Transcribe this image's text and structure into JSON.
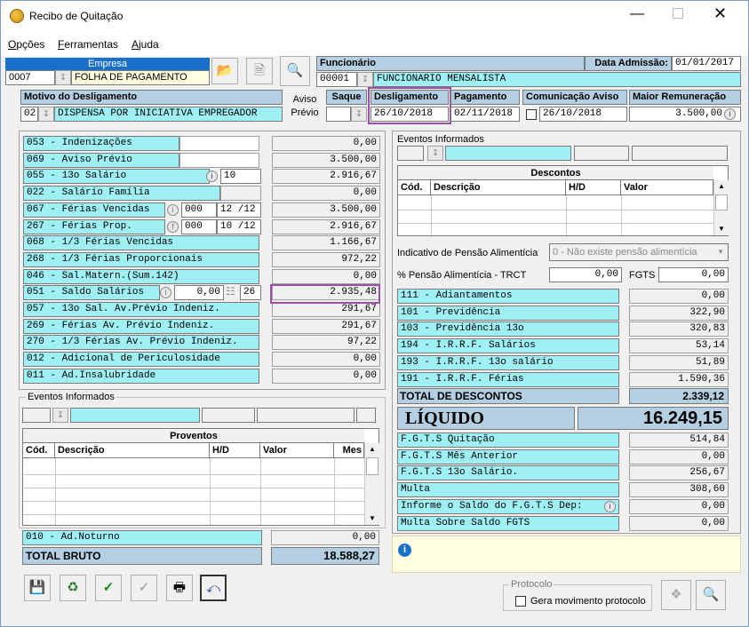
{
  "window": {
    "title": "Recibo de Quitação"
  },
  "menu": [
    {
      "first": "O",
      "rest": "pções"
    },
    {
      "first": "F",
      "rest": "erramentas"
    },
    {
      "first": "A",
      "rest": "juda"
    }
  ],
  "empresa": {
    "label": "Empresa",
    "code": "0007",
    "name": "FOLHA DE PAGAMENTO"
  },
  "funcionario": {
    "label": "Funcionário",
    "code": "00001",
    "name": "FUNCIONARIO MENSALISTA"
  },
  "admissao": {
    "label": "Data Admissão:",
    "value": "01/01/2017"
  },
  "motivo": {
    "label": "Motivo do Desligamento",
    "code": "02",
    "name": "DISPENSA POR INICIATIVA EMPREGADOR"
  },
  "aviso": {
    "line1": "Aviso",
    "line2": "Prévio"
  },
  "saque": {
    "label": "Saque"
  },
  "desligamento": {
    "label": "Desligamento",
    "value": "26/10/2018"
  },
  "pagamento": {
    "label": "Pagamento",
    "value": "02/11/2018"
  },
  "comunicacao": {
    "label": "Comunicação Aviso",
    "value": "26/10/2018"
  },
  "remuneracao": {
    "label": "Maior Remuneração",
    "value": "3.500,00"
  },
  "proventos_rows": [
    {
      "label": "053 - Indenizações",
      "value": "0,00"
    },
    {
      "label": "069 - Aviso Prévio",
      "value": "3.500,00"
    },
    {
      "label": "055 - 13o Salário",
      "extra": "10",
      "value": "2.916,67"
    },
    {
      "label": "022 - Salário Família",
      "value": "0,00"
    },
    {
      "label": "067 - Férias Vencidas",
      "extra": "000",
      "extra2": "12 /12",
      "value": "3.500,00"
    },
    {
      "label": "267 - Férias Prop.",
      "extra": "000",
      "extra2": "10 /12",
      "value": "2.916,67"
    },
    {
      "label": "068 - 1/3 Férias Vencidas",
      "value": "1.166,67"
    },
    {
      "label": "268 - 1/3 Férias Proporcionais",
      "value": "972,22"
    },
    {
      "label": "046 - Sal.Matern.(Sum.142)",
      "value": "0,00"
    },
    {
      "label": "051 - Saldo Salários",
      "extra": "0,00",
      "extra2": "26",
      "value": "2.935,48"
    },
    {
      "label": "057 - 13o Sal. Av.Prévio Indeniz.",
      "value": "291,67"
    },
    {
      "label": "269 - Férias  Av. Prévio Indeniz.",
      "value": "291,67"
    },
    {
      "label": "270 - 1/3 Férias Av. Prévio Indeniz.",
      "value": "97,22"
    },
    {
      "label": "012 - Adicional de Periculosidade",
      "value": "0,00"
    },
    {
      "label": "011 - Ad.Insalubridade",
      "value": "0,00"
    }
  ],
  "eventos_left": {
    "legend": "Eventos Informados",
    "grid_title": "Proventos",
    "columns": [
      "Cód.",
      "Descrição",
      "H/D",
      "Valor",
      "Mes"
    ]
  },
  "adnoturno": {
    "label": "010 - Ad.Noturno",
    "value": "0,00"
  },
  "total_bruto": {
    "label": "TOTAL BRUTO",
    "value": "18.588,27"
  },
  "eventos_right": {
    "legend": "Eventos Informados",
    "grid_title": "Descontos",
    "columns": [
      "Cód.",
      "Descrição",
      "H/D",
      "Valor"
    ]
  },
  "pensao": {
    "label": "Indicativo de Pensão Alimentícia",
    "value": "0 - Não existe pensão alimentícia"
  },
  "pensao_trct": {
    "label": "% Pensão Alimentícia - TRCT",
    "value": "0,00"
  },
  "fgts": {
    "label": "FGTS",
    "value": "0,00"
  },
  "descontos_rows": [
    {
      "label": "111 - Adiantamentos",
      "value": "0,00"
    },
    {
      "label": "101 - Previdência",
      "value": "322,90"
    },
    {
      "label": "103 - Previdência 13o",
      "value": "320,83"
    },
    {
      "label": "194 - I.R.R.F. Salários",
      "value": "53,14"
    },
    {
      "label": "193 - I.R.R.F. 13o salário",
      "value": "51,89"
    },
    {
      "label": "191 - I.R.R.F. Férias",
      "value": "1.590,36"
    }
  ],
  "total_descontos": {
    "label": "TOTAL DE DESCONTOS",
    "value": "2.339,12"
  },
  "liquido": {
    "label": "LÍQUIDO",
    "value": "16.249,15"
  },
  "fgts_rows": [
    {
      "label": "F.G.T.S  Quitação",
      "value": "514,84"
    },
    {
      "label": "F.G.T.S  Mês Anterior",
      "value": "0,00"
    },
    {
      "label": "F.G.T.S  13o Salário.",
      "value": "256,67"
    },
    {
      "label": "Multa",
      "value": "308,60"
    },
    {
      "label": "Informe o Saldo do F.G.T.S Dep:",
      "value": "0,00"
    },
    {
      "label": "Multa Sobre Saldo FGTS",
      "value": "0,00"
    }
  ],
  "protocolo": {
    "legend": "Protocolo",
    "checkbox_label": "Gera movimento protocolo"
  },
  "colors": {
    "accent_purple": "#9b4fa6",
    "cyan": "#9ff0f5",
    "header_blue": "#b4cfe2",
    "info_yellow": "#ffffe1"
  },
  "icons": [
    "app-icon",
    "folder-open-icon",
    "document-icon",
    "magnifier-icon",
    "info-icon",
    "save-icon",
    "recycle-icon",
    "check-icon",
    "check-grey-icon",
    "printer-icon",
    "undo-icon"
  ]
}
